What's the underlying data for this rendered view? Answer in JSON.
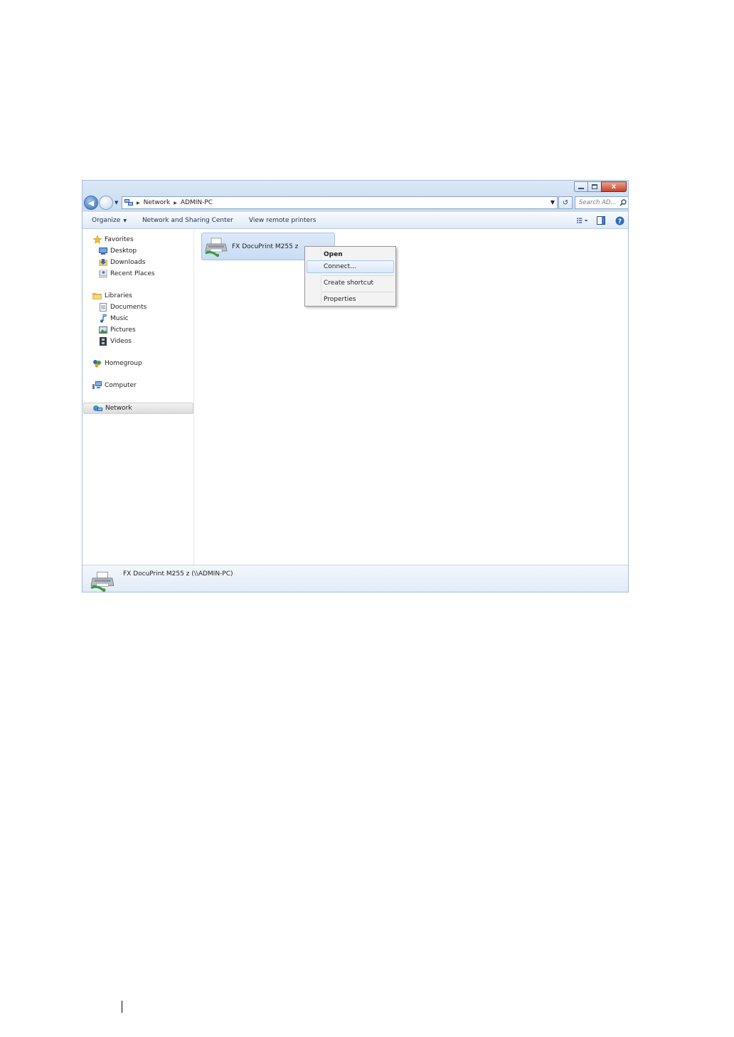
{
  "window": {
    "buttons": {
      "minimize": "–",
      "maximize": "□",
      "close": "x"
    }
  },
  "address": {
    "breadcrumbs": [
      "Network",
      "ADMIN-PC"
    ],
    "search_placeholder": "Search AD..."
  },
  "toolbar": {
    "organize": "Organize",
    "network_sharing": "Network and Sharing Center",
    "view_remote_printers": "View remote printers"
  },
  "navigation": {
    "favorites": "Favorites",
    "desktop": "Desktop",
    "downloads": "Downloads",
    "recent_places": "Recent Places",
    "libraries": "Libraries",
    "documents": "Documents",
    "music": "Music",
    "pictures": "Pictures",
    "videos": "Videos",
    "homegroup": "Homegroup",
    "computer": "Computer",
    "network": "Network"
  },
  "content": {
    "printer_name": "FX DocuPrint M255 z"
  },
  "context_menu": {
    "open": "Open",
    "connect": "Connect...",
    "create_shortcut": "Create shortcut",
    "properties": "Properties"
  },
  "details_pane": {
    "text": "FX DocuPrint M255 z (\\\\ADMIN-PC)"
  },
  "colors": {
    "accent": "#2f6bb8",
    "selection": "#c8dcf4",
    "close_button": "#c8422a"
  }
}
